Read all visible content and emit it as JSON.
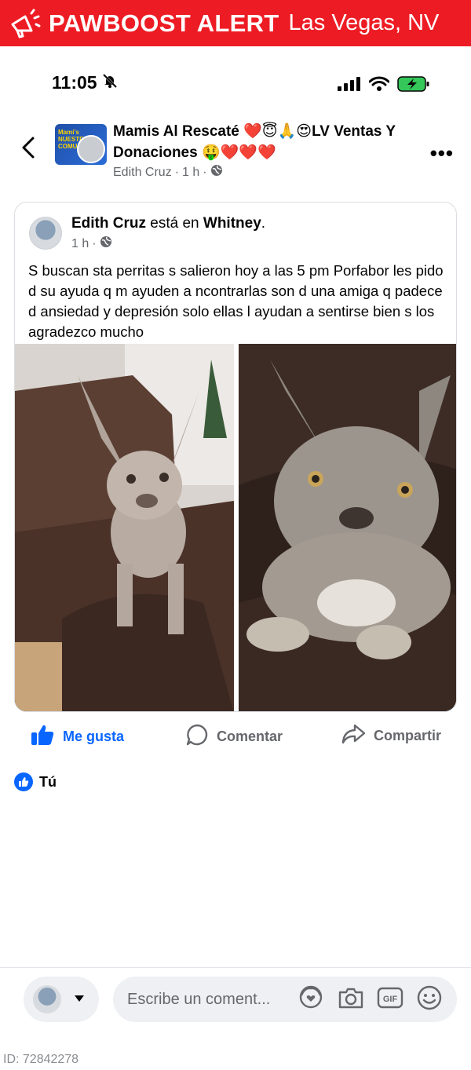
{
  "banner": {
    "brand": "PAWBOOST ALERT",
    "location": "Las Vegas, NV",
    "color": "#ed1c24"
  },
  "status_bar": {
    "time": "11:05"
  },
  "group": {
    "title": "Mamis Al Rescaté ❤️😇🙏😍LV Ventas Y Donaciones 🤑❤️❤️❤️",
    "avatar_text": "Mami's NUESTRA COMUNIDAD",
    "author": "Edith Cruz",
    "time": "1 h"
  },
  "post": {
    "author": "Edith Cruz",
    "connector": "está en",
    "place": "Whitney",
    "time": "1 h",
    "text": "S buscan sta perritas s salieron hoy a las 5 pm Porfabor les pido d su ayuda q m ayuden a ncontrarlas son d una amiga q padece d ansiedad y depresión solo ellas l ayudan a sentirse bien s los agradezco mucho"
  },
  "actions": {
    "like": "Me gusta",
    "comment": "Comentar",
    "share": "Compartir"
  },
  "reactions": {
    "label": "Tú"
  },
  "composer": {
    "placeholder": "Escribe un coment..."
  },
  "footer": {
    "id": "ID: 72842278"
  },
  "colors": {
    "accent": "#0866ff",
    "muted": "#65676b"
  }
}
